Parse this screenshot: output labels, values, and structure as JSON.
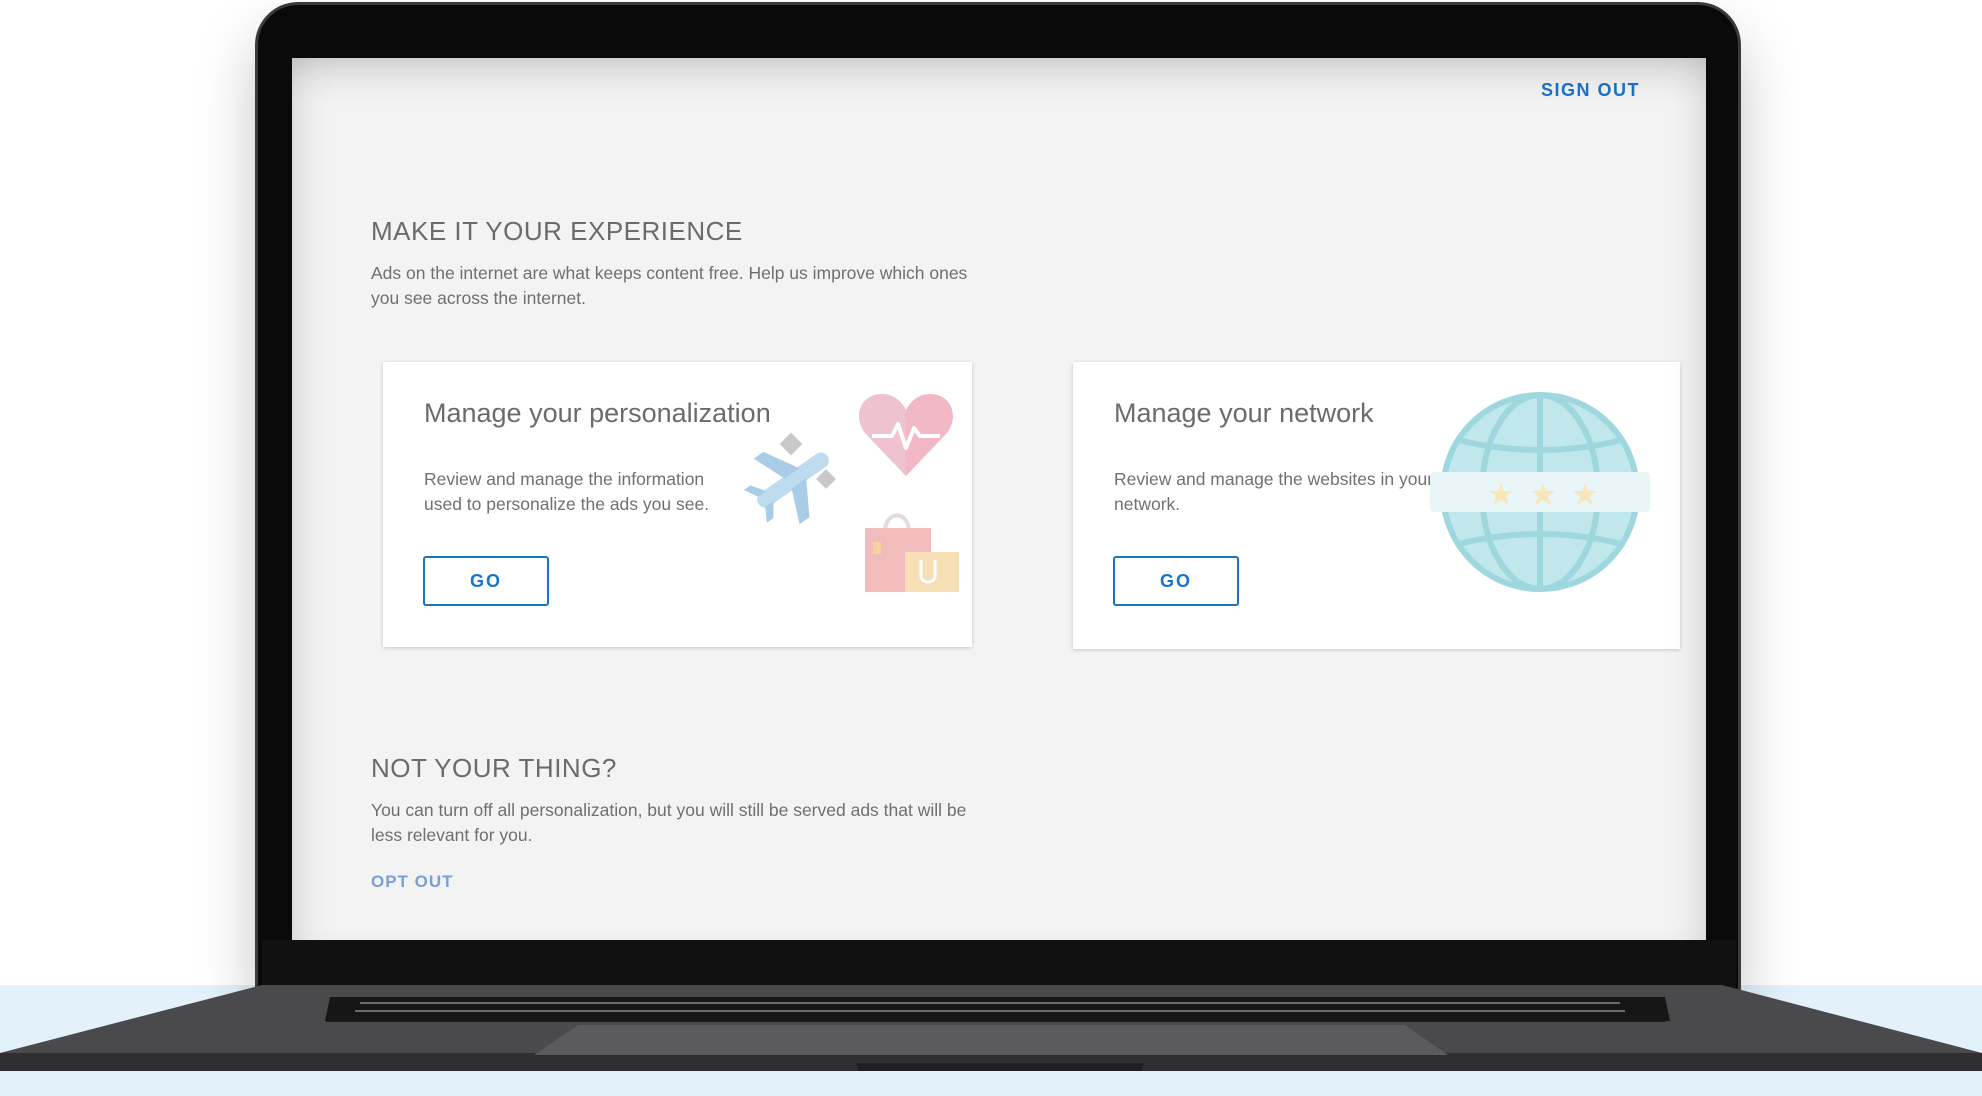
{
  "header": {
    "sign_out_label": "SIGN OUT"
  },
  "experience": {
    "title": "MAKE IT YOUR EXPERIENCE",
    "description": "Ads on the internet are what keeps content free. Help us improve which ones you see across the internet."
  },
  "cards": [
    {
      "title": "Manage your personalization",
      "description": "Review and manage the information used to personalize the ads you see.",
      "button_label": "GO",
      "illustration": [
        "heart-pulse-icon",
        "airplane-icon",
        "shopping-bags-icon"
      ]
    },
    {
      "title": "Manage your network",
      "description": "Review and manage the websites in your network.",
      "button_label": "GO",
      "illustration": [
        "globe-icon",
        "star-rating-icon"
      ]
    }
  ],
  "opt_out_section": {
    "title": "NOT YOUR THING?",
    "description": "You can turn off all personalization, but you will still be served ads that will be less relevant for you.",
    "link_label": "OPT OUT"
  },
  "colors": {
    "accent": "#1a73c9",
    "opt_out_link": "#7a9fd6",
    "screen_background": "#f3f3f3",
    "text": "#6b6b6b"
  }
}
